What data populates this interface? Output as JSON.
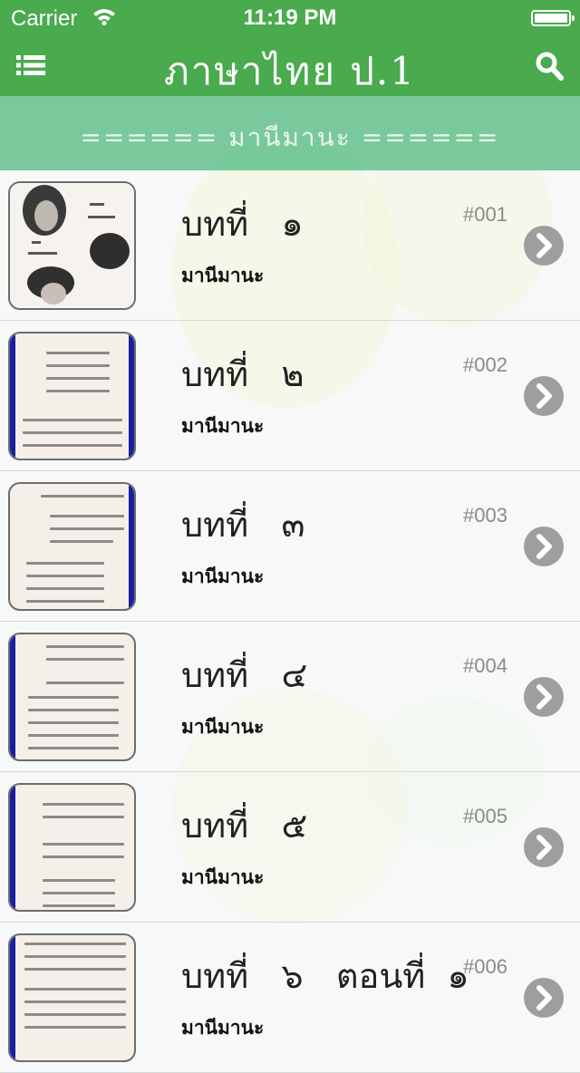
{
  "status_bar": {
    "carrier": "Carrier",
    "time": "11:19 PM"
  },
  "nav": {
    "title": "ภาษาไทย  ป.1",
    "menu_icon": "list-icon",
    "search_icon": "search-icon"
  },
  "section": {
    "title": "======  มานีมานะ  ======"
  },
  "lessons": [
    {
      "title": "บทที่   ๑",
      "subtitle": "มานีมานะ",
      "number": "#001"
    },
    {
      "title": "บทที่   ๒",
      "subtitle": "มานีมานะ",
      "number": "#002"
    },
    {
      "title": "บทที่   ๓",
      "subtitle": "มานีมานะ",
      "number": "#003"
    },
    {
      "title": "บทที่   ๔",
      "subtitle": "มานีมานะ",
      "number": "#004"
    },
    {
      "title": "บทที่   ๕",
      "subtitle": "มานีมานะ",
      "number": "#005"
    },
    {
      "title": "บทที่   ๖   ตอนที่  ๑",
      "subtitle": "มานีมานะ",
      "number": "#006"
    }
  ],
  "colors": {
    "accent": "#4aaa4e",
    "banner": "#6cc494",
    "chevron": "#9e9e9e"
  }
}
